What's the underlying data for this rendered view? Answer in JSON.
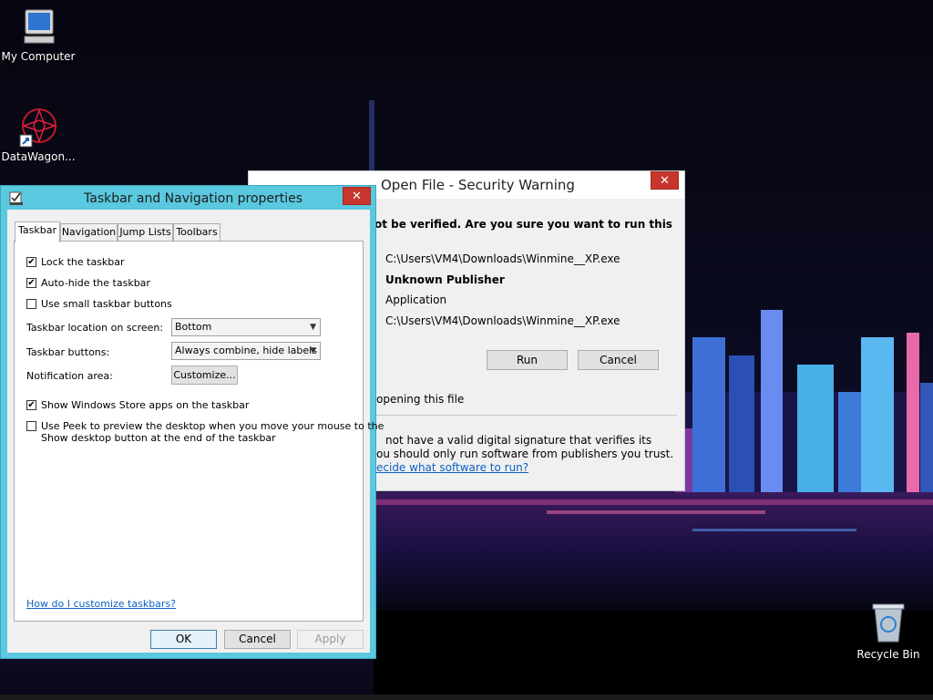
{
  "desktop": {
    "icons": [
      {
        "label": "My Computer",
        "icon": "computer-icon"
      },
      {
        "label": "DataWagon...",
        "icon": "datawagon-shortcut-icon"
      },
      {
        "label": "Recycle Bin",
        "icon": "recycle-bin-icon"
      }
    ]
  },
  "security_dialog": {
    "title": "Open File - Security Warning",
    "question": "ot be verified.  Are you sure you want to run this",
    "name": "C:\\Users\\VM4\\Downloads\\Winmine__XP.exe",
    "publisher": "Unknown Publisher",
    "type": "Application",
    "from": "C:\\Users\\VM4\\Downloads\\Winmine__XP.exe",
    "run_label": "Run",
    "cancel_label": "Cancel",
    "checkbox_text": "opening this file",
    "warning_line1": "not have a valid digital signature that verifies its",
    "warning_line2": "ou should only run software from publishers you trust.",
    "warning_link": "ecide what software to run?",
    "close_label": "✕"
  },
  "taskbar_dialog": {
    "title": "Taskbar and Navigation properties",
    "close_label": "✕",
    "tabs": [
      "Taskbar",
      "Navigation",
      "Jump Lists",
      "Toolbars"
    ],
    "options": {
      "lock": {
        "label": "Lock the taskbar",
        "checked": "✔"
      },
      "autohide": {
        "label": "Auto-hide the taskbar",
        "checked": "✔"
      },
      "small": {
        "label": "Use small taskbar buttons",
        "checked": ""
      },
      "store": {
        "label": "Show Windows Store apps on the taskbar",
        "checked": "✔"
      },
      "peek": {
        "label_line1": "Use Peek to preview the desktop when you move your mouse to the",
        "label_line2": "Show desktop button at the end of the taskbar",
        "checked": ""
      }
    },
    "location_label": "Taskbar location on screen:",
    "location_value": "Bottom",
    "buttons_label": "Taskbar buttons:",
    "buttons_value": "Always combine, hide labels",
    "notification_label": "Notification area:",
    "customize_label": "Customize...",
    "help_link": "How do I customize taskbars?",
    "ok_label": "OK",
    "cancel_label": "Cancel",
    "apply_label": "Apply"
  }
}
